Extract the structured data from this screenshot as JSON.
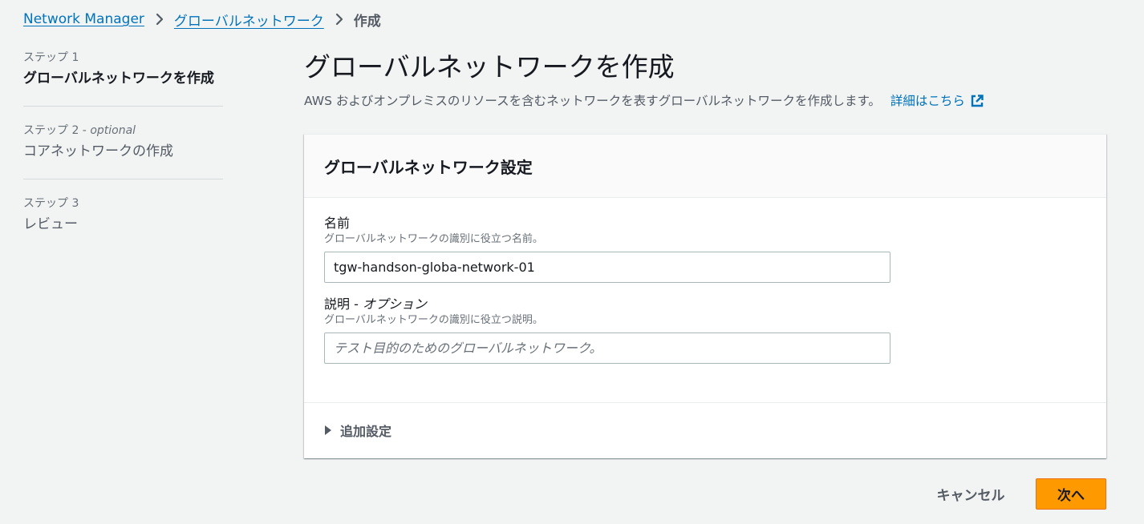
{
  "breadcrumb": {
    "items": [
      {
        "label": "Network Manager"
      },
      {
        "label": "グローバルネットワーク"
      }
    ],
    "current": "作成",
    "separator_icon": "chevron-right-icon"
  },
  "steps": [
    {
      "label": "ステップ 1",
      "label_suffix": "",
      "title": "グローバルネットワークを作成",
      "active": true
    },
    {
      "label": "ステップ 2 - ",
      "label_suffix": "optional",
      "title": "コアネットワークの作成",
      "active": false
    },
    {
      "label": "ステップ 3",
      "label_suffix": "",
      "title": "レビュー",
      "active": false
    }
  ],
  "header": {
    "title": "グローバルネットワークを作成",
    "description": "AWS およびオンプレミスのリソースを含むネットワークを表すグローバルネットワークを作成します。",
    "learn_more": "詳細はこちら",
    "learn_more_icon": "external-link-icon"
  },
  "panel": {
    "title": "グローバルネットワーク設定",
    "name_field": {
      "label": "名前",
      "description": "グローバルネットワークの識別に役立つ名前。",
      "value": "tgw-handson-globa-network-01"
    },
    "description_field": {
      "label": "説明 - ",
      "label_suffix": "オプション",
      "description": "グローバルネットワークの識別に役立つ説明。",
      "value": "",
      "placeholder": "テスト目的のためのグローバルネットワーク。"
    },
    "additional_settings": {
      "label": "追加設定",
      "icon": "caret-right-icon"
    }
  },
  "actions": {
    "cancel": "キャンセル",
    "next": "次へ"
  },
  "colors": {
    "link": "#0073bb",
    "primary_button": "#ff9900",
    "background": "#f2f3f3"
  }
}
